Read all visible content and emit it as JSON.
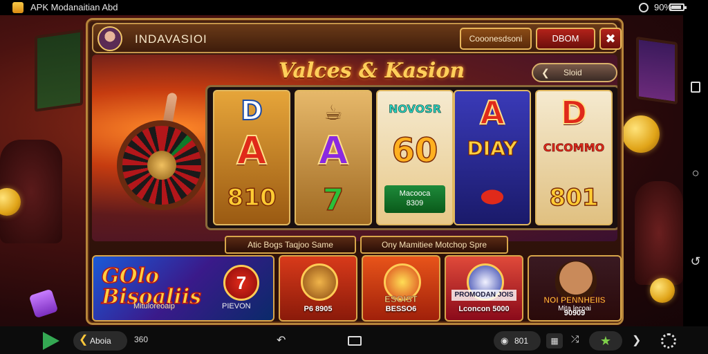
{
  "statusbar": {
    "title": "APK Modanaitian Abd",
    "battery_text": "90%"
  },
  "header": {
    "player_name": "INDAVASIOI",
    "gold_button": "Cooonesdsoni",
    "red_button": "DBOM",
    "close_icon": "✖"
  },
  "banner": {
    "title": "Valces & Kasion",
    "sort_label": "Sloid"
  },
  "reels": [
    {
      "top": "D",
      "middle": "A",
      "bottom": "810"
    },
    {
      "top": "",
      "middle": "A",
      "bottom": "7"
    },
    {
      "top": "NOVOSR",
      "middle": "60",
      "pill_line1": "Macooca",
      "pill_line2": "8309"
    },
    {
      "top": "A",
      "middle": "DIAY",
      "bottom": ""
    },
    {
      "top": "D",
      "middle": "CICOMMO",
      "bottom": "801"
    }
  ],
  "promos": {
    "left": "Atic Bogs Taqjoo Same",
    "right": "Ony Mamitiee Motchop Spre"
  },
  "tiles": {
    "bonus_title_1": "GOlo",
    "bonus_title_2": "Bisoaliis",
    "bonus_sub": "Mituloreoaip",
    "bonus_badge": "7",
    "bonus_label": "PIEVON",
    "tile2_label": "P6 8905",
    "tile3_emblem": "ESOIST",
    "tile3_label": "BESSO6",
    "tile4_emblem": "PROMODAN JOIS",
    "tile4_label": "Lconcon 5000",
    "tile5_name": "NOI PENNHEIIS",
    "tile5_mini": "Mita lecoai",
    "tile5_value": "90909"
  },
  "bottombar": {
    "back_label": "Aboia",
    "count": "360",
    "location_value": "801"
  }
}
